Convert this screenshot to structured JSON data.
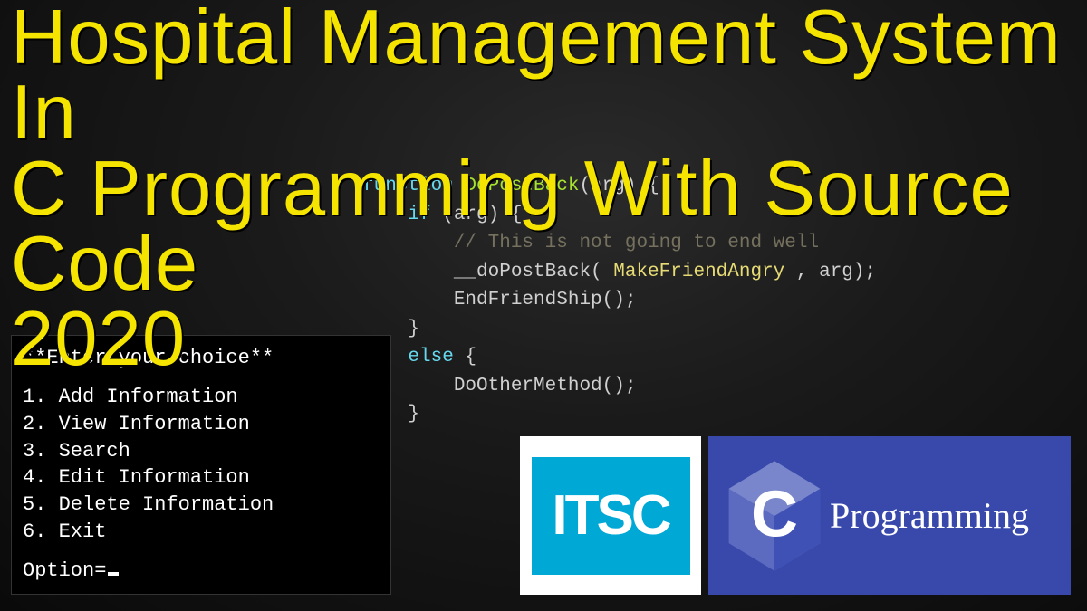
{
  "headline": {
    "line1": "Hospital Management System In",
    "line2": "C Programming With Source Code",
    "line3": "2020"
  },
  "code": {
    "l1a": "function ",
    "l1b": "DoPostBack",
    "l1c": "(arg) {",
    "l2a": "    if ",
    "l2b": "(arg) {",
    "l3": "        // This is not going to end well",
    "l4a": "        __doPostBack( ",
    "l4b": "MakeFriendAngry",
    "l4c": " , arg);",
    "l5": "        EndFriendShip();",
    "l6": "    }",
    "l7a": "    else ",
    "l7b": "{",
    "l8": "        DoOtherMethod();",
    "l9": "    }",
    "l10": "}"
  },
  "terminal": {
    "title": "**Enter your choice**",
    "items": [
      "1. Add Information",
      "2. View Information",
      "3. Search",
      "4. Edit Information",
      "5. Delete Information",
      "6. Exit"
    ],
    "prompt": "Option="
  },
  "logos": {
    "itsc": "ITSC",
    "c": "C",
    "programming": "Programming"
  }
}
